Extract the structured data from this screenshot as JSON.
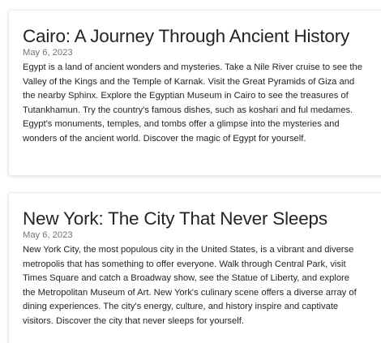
{
  "posts": [
    {
      "title": "Cairo: A Journey Through Ancient History",
      "date": "May 6, 2023",
      "body": "Egypt is a land of ancient wonders and mysteries. Take a Nile River cruise to see the Valley of the Kings and the Temple of Karnak. Visit the Great Pyramids of Giza and the nearby Sphinx. Explore the Egyptian Museum in Cairo to see the treasures of Tutankhamun. Try the country's famous dishes, such as koshari and ful medames. Egypt's monuments, temples, and tombs offer a glimpse into the mysteries and wonders of the ancient world. Discover the magic of Egypt for yourself."
    },
    {
      "title": "New York: The City That Never Sleeps",
      "date": "May 6, 2023",
      "body": "New York City, the most populous city in the United States, is a vibrant and diverse metropolis that has something to offer everyone. Walk through Central Park, visit Times Square and catch a Broadway show, see the Statue of Liberty, and explore the Metropolitan Museum of Art. New York's culinary scene offers a diverse array of dining experiences. The city's energy, culture, and history inspire and captivate visitors. Discover the city that never sleeps for yourself."
    }
  ]
}
